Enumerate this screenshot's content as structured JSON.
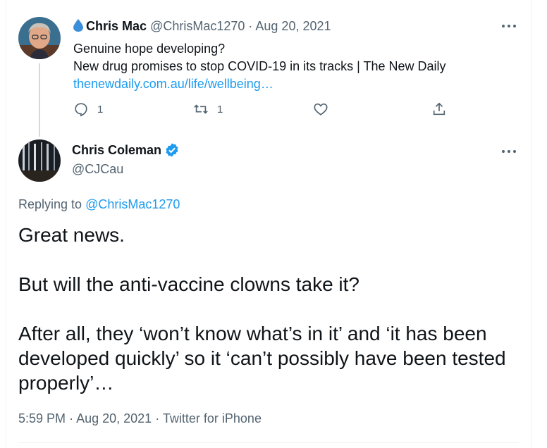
{
  "parent_tweet": {
    "display_name": "Chris Mac",
    "handle": "@ChrisMac1270",
    "separator": "·",
    "date": "Aug 20, 2021",
    "text_line1": "Genuine hope developing?",
    "text_line2": "New drug promises to stop COVID-19 in its tracks | The New Daily",
    "link_text": "thenewdaily.com.au/life/wellbeing…",
    "reply_count": "1",
    "retweet_count": "1",
    "icon": "water-drop-icon"
  },
  "main_tweet": {
    "display_name": "Chris Coleman",
    "handle": "@CJCau",
    "replying_prefix": "Replying to",
    "replying_handle": "@ChrisMac1270",
    "text": "Great news.\n\nBut will the anti-vaccine clowns take it?\n\nAfter all, they ‘won’t know what’s in it’ and ‘it has been developed quickly’ so it ‘can’t possibly have been tested properly’…",
    "time": "5:59 PM",
    "date": "Aug 20, 2021",
    "source": "Twitter for iPhone",
    "separator": "·"
  },
  "colors": {
    "link": "#1d9bf0",
    "muted": "#536471",
    "verified": "#1d9bf0"
  }
}
